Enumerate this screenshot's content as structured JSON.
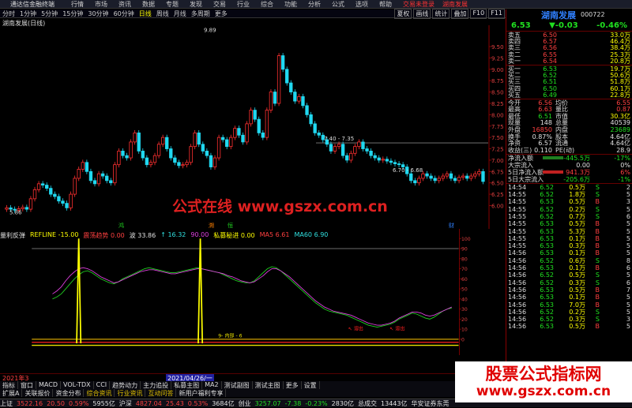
{
  "app": {
    "name": "通达信金融终端",
    "menu": [
      "行情",
      "市场",
      "资讯",
      "数据",
      "专题",
      "发现",
      "交易",
      "行业",
      "综合",
      "功能",
      "分析",
      "公式",
      "选项",
      "帮助"
    ],
    "banner": [
      "交易未登录",
      "湖南发展"
    ],
    "tools": [
      "夏权",
      "画线",
      "统计",
      "叠加",
      "F10",
      "F11"
    ]
  },
  "periods": {
    "items": [
      "分时",
      "1分钟",
      "5分钟",
      "15分钟",
      "30分钟",
      "60分钟",
      "日线",
      "周线",
      "月线",
      "多周期",
      "更多"
    ],
    "active": "日线",
    "right_buttons": [
      "夏权",
      "画线",
      "统计",
      "叠加",
      "F10",
      "F11"
    ]
  },
  "chart_title": "湖南发展(日线)",
  "chart_data": {
    "type": "candlestick",
    "ylim": [
      5.8,
      9.9
    ],
    "y_ticks": [
      "9.50",
      "9.25",
      "9.00",
      "8.75",
      "8.50",
      "8.25",
      "8.00",
      "7.75",
      "7.50",
      "7.25",
      "7.00",
      "6.75",
      "6.50",
      "6.25",
      "6.00"
    ],
    "annotations": [
      "9.89",
      "7.40 - 7.35",
      "6.70 - 6.68",
      "5.86"
    ],
    "closes": [
      5.95,
      5.92,
      5.9,
      5.93,
      5.96,
      5.92,
      6.15,
      6.35,
      6.48,
      6.45,
      6.38,
      6.25,
      6.2,
      6.1,
      6.05,
      5.95,
      6.25,
      6.6,
      6.8,
      6.95,
      6.75,
      6.55,
      6.48,
      6.7,
      6.65,
      6.55,
      6.5,
      6.9,
      7.2,
      7.1,
      7.05,
      7.4,
      7.6,
      7.2,
      7.05,
      6.9,
      6.95,
      7.1,
      7.35,
      7.5,
      7.25,
      7.05,
      6.95,
      6.88,
      6.9,
      6.95,
      7.3,
      7.6,
      7.35,
      7.2,
      7.1,
      6.85,
      7.05,
      7.5,
      7.45,
      7.3,
      7.5,
      7.7,
      7.55,
      7.4,
      7.8,
      8.1,
      7.9,
      7.6,
      7.5,
      8.1,
      8.5,
      8.25,
      9.3,
      9.0,
      8.7,
      8.5,
      8.3,
      8.4,
      8.2,
      8.0,
      7.8,
      7.6,
      7.55,
      7.45,
      7.35,
      7.2,
      7.3,
      7.35,
      7.1,
      7.0,
      7.15,
      7.3,
      7.4,
      7.25,
      7.2,
      7.1,
      7.05,
      7.0,
      7.02,
      6.98,
      6.95,
      6.92,
      6.9,
      6.85,
      6.7,
      6.55,
      6.5,
      6.6,
      6.7,
      6.65,
      6.6,
      6.55,
      6.6,
      6.65,
      6.7,
      6.6,
      6.55,
      6.62,
      6.65,
      6.6,
      6.65,
      6.7,
      6.75,
      6.53
    ]
  },
  "indicator": {
    "name": "量利反弹",
    "refline": "REFLINE -15.00",
    "items": [
      "震荡趋势 0.00",
      "波 33.86",
      "↑ 16.32",
      "90.00",
      "私募秘进 0.00",
      "MA5 6.61",
      "MA60 6.90"
    ],
    "panel_labels": [
      "鸿",
      "溯",
      "恒",
      "财"
    ],
    "y_ticks": [
      "100",
      "90",
      "80",
      "70",
      "60",
      "50",
      "40",
      "30",
      "20",
      "10",
      "0"
    ],
    "annotations": [
      "9- 内部 - 6",
      "↖ 溶出",
      "↖ 溶出"
    ],
    "series_a": [
      40,
      42,
      45,
      50,
      55,
      60,
      64,
      67,
      68,
      66,
      63,
      60,
      58,
      56,
      55,
      57,
      60,
      62,
      64,
      66,
      68,
      70,
      71,
      70,
      69,
      68,
      67,
      66,
      66,
      67,
      68,
      69,
      70,
      71,
      70,
      69,
      68,
      67,
      66,
      64,
      62,
      60,
      58,
      57,
      56,
      56,
      58,
      62,
      66,
      70,
      72,
      71,
      68,
      64,
      60,
      56,
      52,
      48,
      44,
      40,
      36,
      33,
      30,
      28,
      27,
      26,
      25,
      24,
      22,
      20,
      18,
      16,
      14,
      13,
      12,
      13,
      14,
      15,
      17,
      20,
      22,
      24,
      26,
      25,
      23,
      21,
      20,
      22,
      25,
      28,
      30,
      31
    ],
    "series_b": [
      45,
      48,
      52,
      58,
      63,
      67,
      70,
      71,
      70,
      68,
      65,
      62,
      60,
      58,
      56,
      57,
      59,
      61,
      63,
      65,
      67,
      68,
      69,
      69,
      68,
      67,
      66,
      65,
      65,
      66,
      67,
      68,
      69,
      70,
      70,
      69,
      68,
      67,
      66,
      65,
      63,
      62,
      60,
      58,
      57,
      56,
      57,
      60,
      63,
      67,
      70,
      70,
      68,
      65,
      62,
      58,
      54,
      50,
      46,
      42,
      38,
      35,
      32,
      30,
      28,
      27,
      26,
      25,
      24,
      22,
      20,
      18,
      16,
      15,
      14,
      14,
      15,
      16,
      18,
      21,
      23,
      25,
      27,
      27,
      26,
      24,
      23,
      24,
      26,
      28,
      30,
      32
    ]
  },
  "date_bar": {
    "left": "2021年3",
    "selected": "2021/04/26/一"
  },
  "tabs1": [
    "指标",
    "窗口",
    "MACD",
    "VOL-TDX",
    "CCI",
    "趋势动力",
    "主力追投",
    "私募主图",
    "MA2",
    "测试副图",
    "测试主图",
    "更多",
    "设置"
  ],
  "tabs2": [
    {
      "t": "扩展A",
      "y": false
    },
    {
      "t": "关联报价",
      "y": false
    },
    {
      "t": "资金分布",
      "y": false
    },
    {
      "t": "综合资讯",
      "y": true
    },
    {
      "t": "行业资讯",
      "y": true
    },
    {
      "t": "互动问答",
      "y": true
    },
    {
      "t": "新用户福利专享",
      "y": false
    }
  ],
  "status": {
    "sh_label": "上证",
    "sh_val": "3522.16",
    "sh_chg": "20.50",
    "sh_pct": "0.59%",
    "sh_amt": "5955亿",
    "sz_label": "沪深",
    "sz_val": "4827.04",
    "sz_chg": "25.43",
    "sz_pct": "0.53%",
    "sz_amt": "3684亿",
    "cy_label": "创业",
    "cy_val": "3257.07",
    "cy_chg": "-7.38",
    "cy_pct": "-0.23%",
    "cy_amt": "2830亿",
    "total_label": "总成交",
    "total_amt": "13443亿",
    "broker": "华安证券东莞"
  },
  "quote": {
    "name": "湖南发展",
    "code": "000722",
    "price": "6.53",
    "change": "▼-0.03",
    "pct": "-0.46%",
    "asks": [
      {
        "l": "卖五",
        "p": "6.50",
        "v": "33.0万"
      },
      {
        "l": "卖四",
        "p": "6.57",
        "v": "46.4万"
      },
      {
        "l": "卖三",
        "p": "6.56",
        "v": "38.4万"
      },
      {
        "l": "卖二",
        "p": "6.55",
        "v": "25.3万"
      },
      {
        "l": "卖一",
        "p": "6.54",
        "v": "20.8万"
      }
    ],
    "bids": [
      {
        "l": "买一",
        "p": "6.53",
        "v": "19.7万"
      },
      {
        "l": "买二",
        "p": "6.52",
        "v": "50.6万"
      },
      {
        "l": "买三",
        "p": "6.51",
        "v": "51.8万"
      },
      {
        "l": "买四",
        "p": "6.50",
        "v": "60.1万"
      },
      {
        "l": "买五",
        "p": "6.49",
        "v": "22.8万"
      }
    ],
    "stats": [
      {
        "a": "今开",
        "b": "6.56",
        "bc": "r",
        "c": "均价",
        "d": "6.55",
        "dc": "r"
      },
      {
        "a": "最高",
        "b": "6.63",
        "bc": "r",
        "c": "量比",
        "d": "0.87",
        "dc": "r"
      },
      {
        "a": "最低",
        "b": "6.51",
        "bc": "g",
        "c": "市值",
        "d": "30.3亿",
        "dc": "y"
      },
      {
        "a": "现量",
        "b": "148",
        "bc": "w",
        "c": "总量",
        "d": "40539",
        "dc": "w"
      },
      {
        "a": "外盘",
        "b": "16850",
        "bc": "r",
        "c": "内盘",
        "d": "23689",
        "dc": "g"
      },
      {
        "a": "换手",
        "b": "0.87%",
        "bc": "w",
        "c": "股本",
        "d": "4.64亿",
        "dc": "w"
      },
      {
        "a": "净资",
        "b": "6.57",
        "bc": "w",
        "c": "流通",
        "d": "4.64亿",
        "dc": "w"
      },
      {
        "a": "收益(三)",
        "b": "0.110",
        "bc": "w",
        "c": "PE(动)",
        "d": "28.9",
        "dc": "w"
      }
    ],
    "flows": [
      {
        "a": "净流入额",
        "b": "-445.5万",
        "c": "-17%",
        "col": "g",
        "bar": "#208020"
      },
      {
        "a": "大宗流入",
        "b": "0.00",
        "c": "0%",
        "col": "w",
        "bar": "#000"
      },
      {
        "a": "5日净流入额",
        "b": "941.3万",
        "c": "6%",
        "col": "r",
        "bar": "#c02020"
      },
      {
        "a": "5日大宗流入",
        "b": "-205.6万",
        "c": "-1%",
        "col": "g",
        "bar": "#000"
      }
    ],
    "ticks": [
      {
        "t": "14:54",
        "p": "6.52",
        "pc": "g",
        "v": "0.5万",
        "s": "S",
        "sc": "g",
        "n": "2"
      },
      {
        "t": "14:55",
        "p": "6.52",
        "pc": "g",
        "v": "1.8万",
        "s": "S",
        "sc": "g",
        "n": "5"
      },
      {
        "t": "14:55",
        "p": "6.53",
        "pc": "g",
        "v": "0.5万",
        "s": "B",
        "sc": "r",
        "n": "3"
      },
      {
        "t": "14:55",
        "p": "6.52",
        "pc": "g",
        "v": "0.2万",
        "s": "S",
        "sc": "g",
        "n": "5"
      },
      {
        "t": "14:55",
        "p": "6.52",
        "pc": "g",
        "v": "0.7万",
        "s": "S",
        "sc": "g",
        "n": "6"
      },
      {
        "t": "14:55",
        "p": "6.53",
        "pc": "g",
        "v": "0.5万",
        "s": "B",
        "sc": "r",
        "n": "5"
      },
      {
        "t": "14:55",
        "p": "6.53",
        "pc": "g",
        "v": "5.3万",
        "s": "B",
        "sc": "r",
        "n": "5"
      },
      {
        "t": "14:55",
        "p": "6.53",
        "pc": "g",
        "v": "0.1万",
        "s": "B",
        "sc": "r",
        "n": "5"
      },
      {
        "t": "14:55",
        "p": "6.53",
        "pc": "g",
        "v": "0.3万",
        "s": "B",
        "sc": "r",
        "n": "5"
      },
      {
        "t": "14:56",
        "p": "6.53",
        "pc": "g",
        "v": "0.1万",
        "s": "B",
        "sc": "r",
        "n": "5"
      },
      {
        "t": "14:56",
        "p": "6.52",
        "pc": "g",
        "v": "0.6万",
        "s": "S",
        "sc": "g",
        "n": "8"
      },
      {
        "t": "14:56",
        "p": "6.53",
        "pc": "g",
        "v": "0.1万",
        "s": "B",
        "sc": "r",
        "n": "6"
      },
      {
        "t": "14:56",
        "p": "6.52",
        "pc": "g",
        "v": "0.5万",
        "s": "S",
        "sc": "g",
        "n": "5"
      },
      {
        "t": "14:56",
        "p": "6.52",
        "pc": "g",
        "v": "0.3万",
        "s": "S",
        "sc": "g",
        "n": "6"
      },
      {
        "t": "14:56",
        "p": "6.53",
        "pc": "g",
        "v": "0.5万",
        "s": "B",
        "sc": "r",
        "n": "7"
      },
      {
        "t": "14:56",
        "p": "6.53",
        "pc": "g",
        "v": "0.1万",
        "s": "B",
        "sc": "r",
        "n": "5"
      },
      {
        "t": "14:56",
        "p": "6.53",
        "pc": "g",
        "v": "7.0万",
        "s": "B",
        "sc": "r",
        "n": "5"
      },
      {
        "t": "14:56",
        "p": "6.52",
        "pc": "g",
        "v": "0.2万",
        "s": "S",
        "sc": "g",
        "n": "5"
      },
      {
        "t": "14:56",
        "p": "6.52",
        "pc": "g",
        "v": "0.3万",
        "s": "S",
        "sc": "g",
        "n": "3"
      },
      {
        "t": "14:56",
        "p": "6.53",
        "pc": "g",
        "v": "0.5万",
        "s": "B",
        "sc": "r",
        "n": "5"
      }
    ]
  },
  "watermark_center": "公式在线 www.gszx.com.cn",
  "watermark_corner": {
    "line1": "股票公式指标网",
    "line2": "www.gszx.com.cn"
  }
}
